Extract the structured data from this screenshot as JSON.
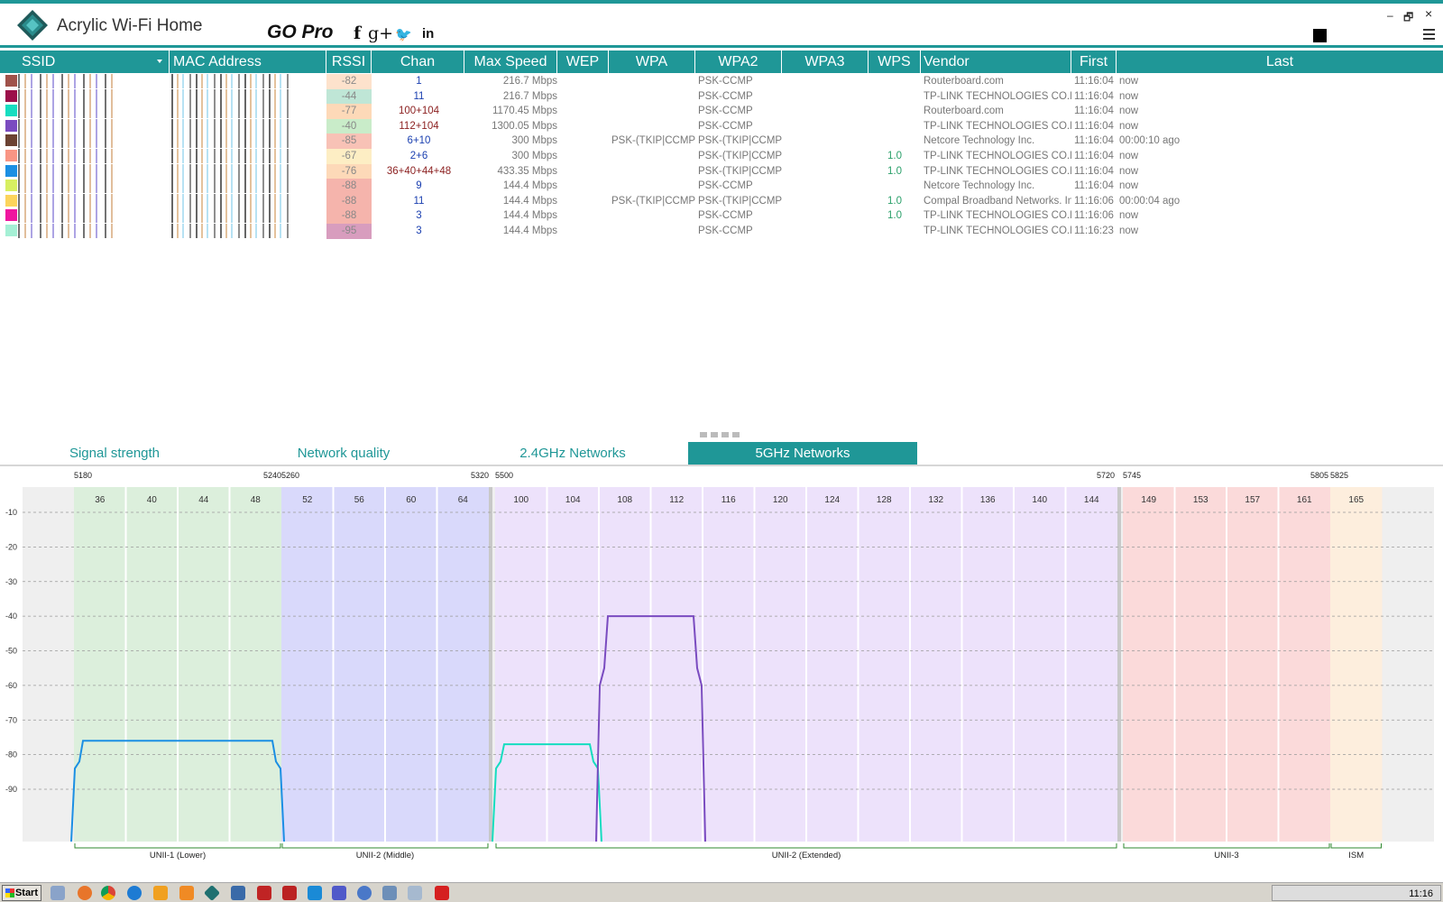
{
  "app": {
    "title": "Acrylic Wi-Fi Home",
    "go_pro": "GO Pro",
    "social_icons": [
      "facebook-icon",
      "google-plus-icon",
      "twitter-icon",
      "linkedin-icon"
    ],
    "facebook_glyph": "f",
    "gplus_glyph": "g+",
    "twitter_glyph": "🐦",
    "linkedin_glyph": "in",
    "minimize_glyph": "–",
    "restore_glyph": "🗗",
    "close_glyph": "×"
  },
  "colors": {
    "accent": "#1f9797",
    "unii1": "#dcefdc",
    "unii2m": "#d9d9fb",
    "unii2e": "#ede2fb",
    "unii3": "#fbdada",
    "ism": "#fdeedd",
    "gap": "#efefef"
  },
  "table": {
    "columns": [
      "SSID",
      "MAC Address",
      "RSSI",
      "Chan",
      "Max Speed",
      "WEP",
      "WPA",
      "WPA2",
      "WPA3",
      "WPS",
      "Vendor",
      "First",
      "Last"
    ],
    "rows": [
      {
        "color": "#a0524a",
        "rssi": "-82",
        "rssi_bg": "#fde2cc",
        "chan": "1",
        "chan_color": "blue",
        "speed": "216.7 Mbps",
        "wpa": "",
        "wpa2": "PSK-CCMP",
        "wps": "",
        "vendor": "Routerboard.com",
        "first": "11:16:04",
        "last": "now"
      },
      {
        "color": "#9c0f4a",
        "rssi": "-44",
        "rssi_bg": "#bfe6d6",
        "chan": "11",
        "chan_color": "blue",
        "speed": "216.7 Mbps",
        "wpa": "",
        "wpa2": "PSK-CCMP",
        "wps": "",
        "vendor": "TP-LINK TECHNOLOGIES CO.LTD.",
        "first": "11:16:04",
        "last": "now"
      },
      {
        "color": "#16ddc0",
        "rssi": "-77",
        "rssi_bg": "#fdd9b8",
        "chan": "100+104",
        "chan_color": "red",
        "speed": "1170.45 Mbps",
        "wpa": "",
        "wpa2": "PSK-CCMP",
        "wps": "",
        "vendor": "Routerboard.com",
        "first": "11:16:04",
        "last": "now"
      },
      {
        "color": "#7a4bc0",
        "rssi": "-40",
        "rssi_bg": "#c9ecc9",
        "chan": "112+104",
        "chan_color": "red",
        "speed": "1300.05 Mbps",
        "wpa": "",
        "wpa2": "PSK-CCMP",
        "wps": "",
        "vendor": "TP-LINK TECHNOLOGIES CO.LTD.",
        "first": "11:16:04",
        "last": "now"
      },
      {
        "color": "#6b4232",
        "rssi": "-85",
        "rssi_bg": "#f8c2b6",
        "chan": "6+10",
        "chan_color": "blue",
        "speed": "300 Mbps",
        "wpa": "PSK-(TKIP|CCMP)",
        "wpa2": "PSK-(TKIP|CCMP)",
        "wps": "",
        "vendor": "Netcore Technology Inc.",
        "first": "11:16:04",
        "last": "00:00:10 ago"
      },
      {
        "color": "#f99584",
        "rssi": "-67",
        "rssi_bg": "#fdeec4",
        "chan": "2+6",
        "chan_color": "blue",
        "speed": "300 Mbps",
        "wpa": "",
        "wpa2": "PSK-(TKIP|CCMP)",
        "wps": "1.0",
        "vendor": "TP-LINK TECHNOLOGIES CO.LTD.",
        "first": "11:16:04",
        "last": "now"
      },
      {
        "color": "#1b8fe3",
        "rssi": "-76",
        "rssi_bg": "#fdd9b8",
        "chan": "36+40+44+48",
        "chan_color": "red",
        "speed": "433.35 Mbps",
        "wpa": "",
        "wpa2": "PSK-(TKIP|CCMP)",
        "wps": "1.0",
        "vendor": "TP-LINK TECHNOLOGIES CO.LTD.",
        "first": "11:16:04",
        "last": "now"
      },
      {
        "color": "#d7ef61",
        "rssi": "-88",
        "rssi_bg": "#f5b4ac",
        "chan": "9",
        "chan_color": "blue",
        "speed": "144.4 Mbps",
        "wpa": "",
        "wpa2": "PSK-CCMP",
        "wps": "",
        "vendor": "Netcore Technology Inc.",
        "first": "11:16:04",
        "last": "now"
      },
      {
        "color": "#fcd45c",
        "rssi": "-88",
        "rssi_bg": "#f5b4ac",
        "chan": "11",
        "chan_color": "blue",
        "speed": "144.4 Mbps",
        "wpa": "PSK-(TKIP|CCMP)",
        "wpa2": "PSK-(TKIP|CCMP)",
        "wps": "1.0",
        "vendor": "Compal Broadband Networks. Inc.",
        "first": "11:16:06",
        "last": "00:00:04 ago"
      },
      {
        "color": "#f0169f",
        "rssi": "-88",
        "rssi_bg": "#f5b4ac",
        "chan": "3",
        "chan_color": "blue",
        "speed": "144.4 Mbps",
        "wpa": "",
        "wpa2": "PSK-CCMP",
        "wps": "1.0",
        "vendor": "TP-LINK TECHNOLOGIES CO.LTD.",
        "first": "11:16:06",
        "last": "now"
      },
      {
        "color": "#a5f0d5",
        "rssi": "-95",
        "rssi_bg": "#d89dbe",
        "chan": "3",
        "chan_color": "blue",
        "speed": "144.4 Mbps",
        "wpa": "",
        "wpa2": "PSK-CCMP",
        "wps": "",
        "vendor": "TP-LINK TECHNOLOGIES CO.LTD.",
        "first": "11:16:23",
        "last": "now"
      }
    ]
  },
  "tabs": [
    {
      "label": "Signal strength",
      "active": false
    },
    {
      "label": "Network quality",
      "active": false
    },
    {
      "label": "2.4GHz Networks",
      "active": false
    },
    {
      "label": "5GHz Networks",
      "active": true
    }
  ],
  "chart_data": {
    "type": "line",
    "freq_labels": [
      "5180",
      "5240",
      "5260",
      "5320",
      "5500",
      "5720",
      "5745",
      "5805",
      "5825"
    ],
    "y_ticks": [
      -10,
      -20,
      -30,
      -40,
      -50,
      -60,
      -70,
      -80,
      -90
    ],
    "ylim": [
      -100,
      0
    ],
    "grid": true,
    "bands": [
      {
        "name": "UNII-1 (Lower)",
        "channels": [
          36,
          40,
          44,
          48
        ],
        "color_key": "unii1"
      },
      {
        "name": "UNII-2 (Middle)",
        "channels": [
          52,
          56,
          60,
          64
        ],
        "color_key": "unii2m"
      },
      {
        "name": "UNII-2 (Extended)",
        "channels": [
          100,
          104,
          108,
          112,
          116,
          120,
          124,
          128,
          132,
          136,
          140,
          144
        ],
        "color_key": "unii2e"
      },
      {
        "name": "UNII-3",
        "channels": [
          149,
          153,
          157,
          161
        ],
        "color_key": "unii3"
      },
      {
        "name": "ISM",
        "channels": [
          165
        ],
        "color_key": "ism"
      }
    ],
    "series": [
      {
        "channel_from": 36,
        "channel_to": 48,
        "rssi": -76,
        "color": "#1b8fe3"
      },
      {
        "channel_from": 100,
        "channel_to": 104,
        "rssi": -77,
        "color": "#16ddc0"
      },
      {
        "channel_from": 108,
        "channel_to": 112,
        "rssi": -40,
        "color": "#7a4bc0"
      }
    ]
  },
  "taskbar": {
    "start_label": "Start",
    "clock": "11:16"
  }
}
